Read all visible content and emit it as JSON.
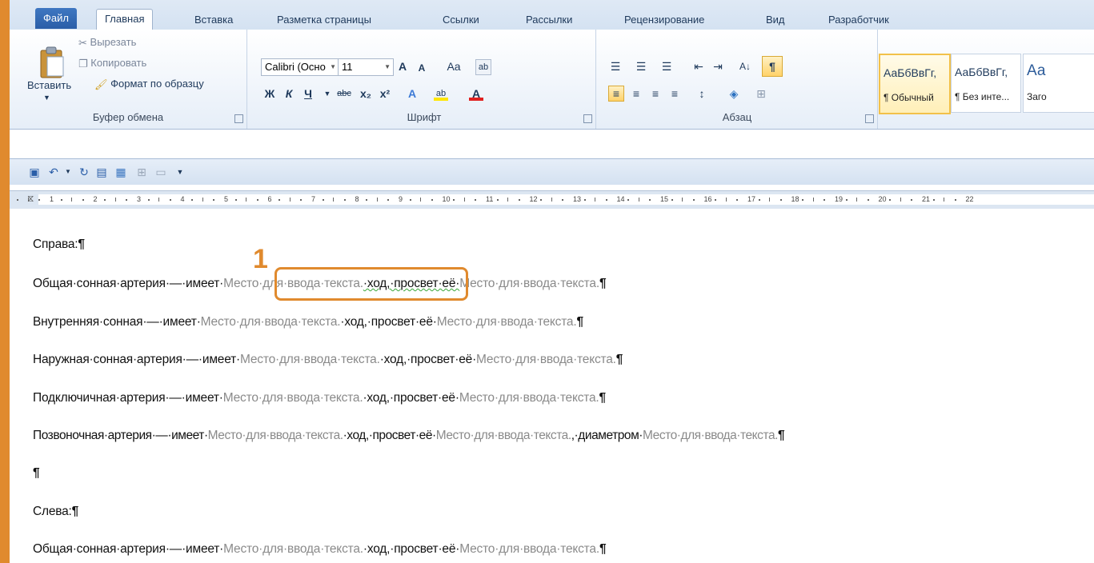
{
  "tabs": [
    "Файл",
    "Главная",
    "Вставка",
    "Разметка страницы",
    "Ссылки",
    "Рассылки",
    "Рецензирование",
    "Вид",
    "Разработчик"
  ],
  "clipboard": {
    "paste": "Вставить",
    "cut": "Вырезать",
    "copy": "Копировать",
    "format_painter": "Формат по образцу",
    "label": "Буфер обмена"
  },
  "font": {
    "name": "Calibri (Осно",
    "size": "11",
    "label": "Шрифт",
    "bold": "Ж",
    "italic": "К",
    "underline": "Ч",
    "strike": "abc",
    "subscript": "x₂",
    "superscript": "x²",
    "grow": "A",
    "shrink": "A",
    "case": "Aa",
    "highlight": "ab",
    "color": "A"
  },
  "paragraph": {
    "label": "Абзац",
    "pilcrow": "¶"
  },
  "styles": [
    {
      "sample": "АаБбВвГг,",
      "name": "¶ Обычный"
    },
    {
      "sample": "АаБбВвГг,",
      "name": "¶ Без инте..."
    },
    {
      "sample": "Аа",
      "name": "Заго"
    }
  ],
  "ruler_numbers": [
    "1",
    "2",
    "3",
    "4",
    "5",
    "6",
    "7",
    "8",
    "9",
    "10",
    "11",
    "12",
    "13",
    "14",
    "15",
    "16",
    "17",
    "18",
    "19",
    "20",
    "21",
    "22"
  ],
  "document": {
    "right_heading": "Справа:",
    "left_heading": "Слева:",
    "placeholder": "Место·для·ввода·текста.",
    "lines": [
      {
        "pre": "Общая·сонная·артерия·—·имеет·",
        "mid": "·ход,·просвет·её·"
      },
      {
        "pre": "Внутренняя·сонная·—·имеет·",
        "mid": "·ход,·просвет·её·"
      },
      {
        "pre": "Наружная·сонная·артерия·—·имеет·",
        "mid": "·ход,·просвет·её·"
      },
      {
        "pre": "Подключичная·артерия·—·имеет·",
        "mid": "·ход,·просвет·её·"
      },
      {
        "pre": "Позвоночная·артерия·—·имеет·",
        "mid": "·ход,·просвет·её·",
        "tail": ",·диаметром·"
      }
    ],
    "left_line": {
      "pre": "Общая·сонная·артерия·—·имеет·",
      "mid": "·ход,·просвет·её·"
    },
    "pilcrow": "¶"
  },
  "callout": {
    "number": "1",
    "color": "#e08a2e"
  }
}
